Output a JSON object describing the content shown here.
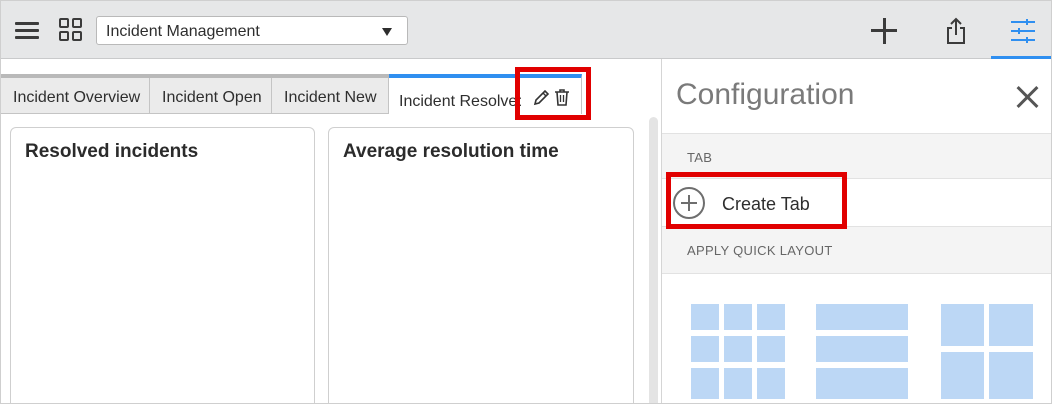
{
  "topbar": {
    "dashboard_selected": "Incident Management"
  },
  "tabs": [
    {
      "label": "Incident Overview"
    },
    {
      "label": "Incident Open"
    },
    {
      "label": "Incident New"
    },
    {
      "label": "Incident Resolved"
    }
  ],
  "widgets": [
    {
      "title": "Resolved incidents"
    },
    {
      "title": "Average resolution time"
    }
  ],
  "config": {
    "title": "Configuration",
    "tab_section": "TAB",
    "create_tab": "Create Tab",
    "layout_section": "APPLY QUICK LAYOUT"
  },
  "colors": {
    "accent": "#2f8ff0",
    "highlight": "#e10000",
    "layout_tile": "#bcd7f5"
  }
}
